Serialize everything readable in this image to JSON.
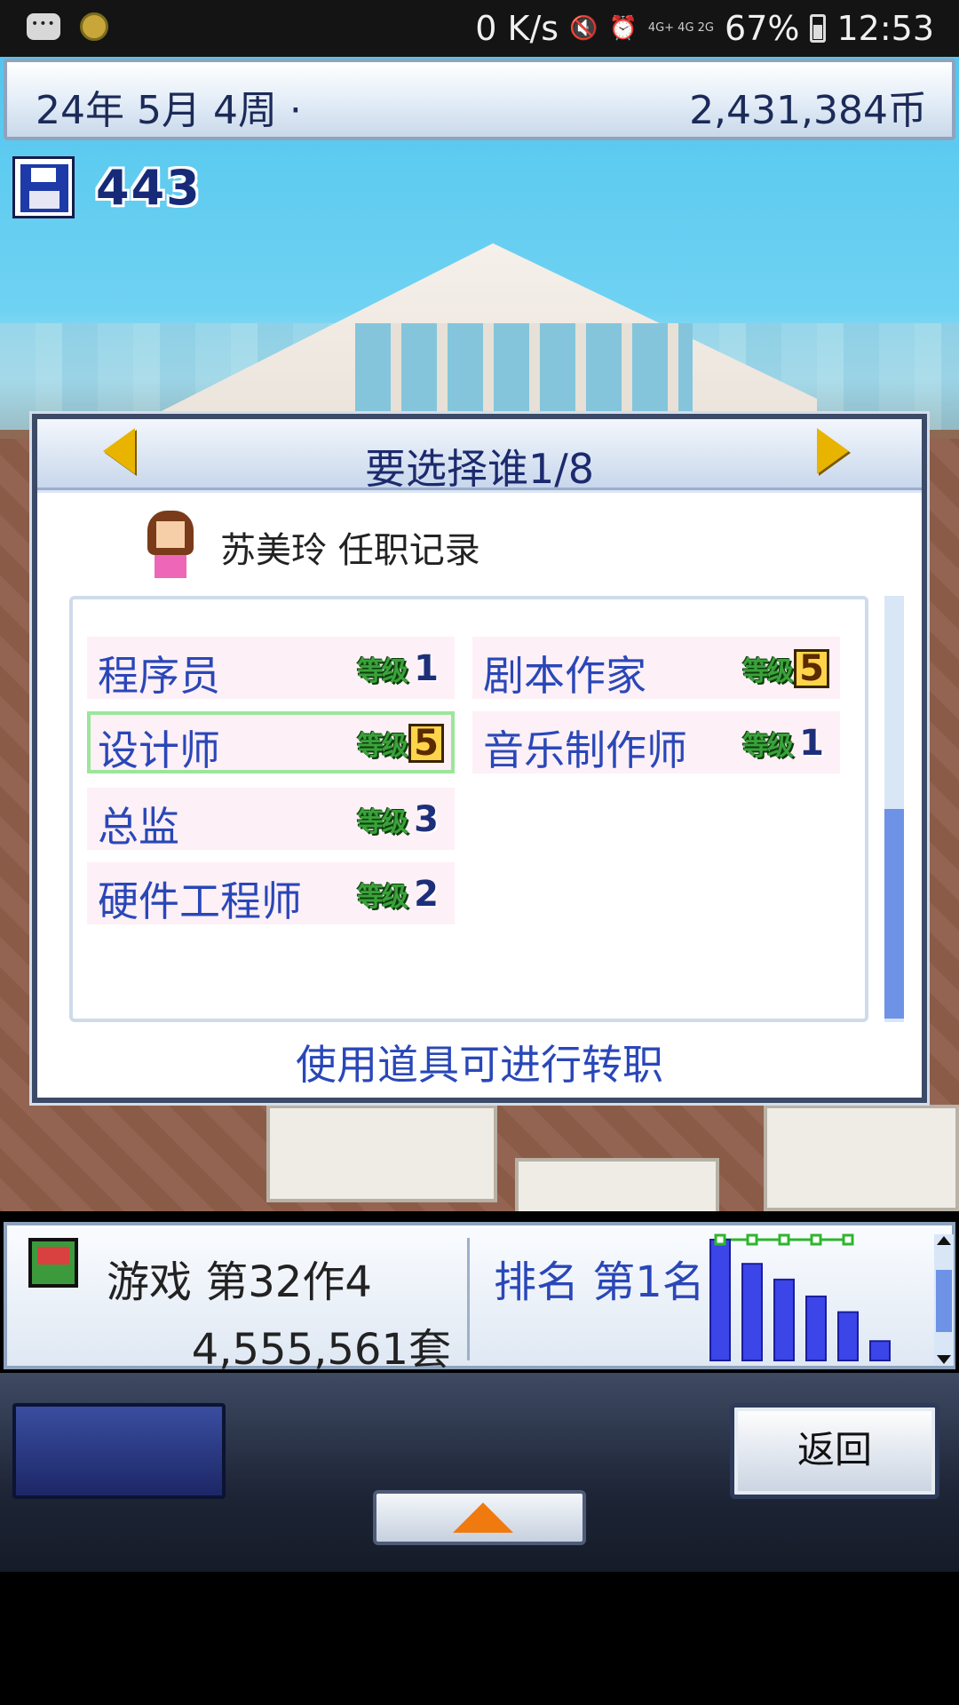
{
  "status_bar": {
    "speed": "0 K/s",
    "network": "4G+ 4G 2G",
    "battery": "67%",
    "time": "12:53"
  },
  "top_bar": {
    "date": "24年 5月 4周 ·",
    "money": "2,431,384币"
  },
  "save_count": "443",
  "dialog": {
    "title": "要选择谁1/8",
    "employee_record": "苏美玲 任职记录",
    "level_label": "等级",
    "jobs": [
      {
        "name": "程序员",
        "level": "1"
      },
      {
        "name": "剧本作家",
        "level": "5"
      },
      {
        "name": "设计师",
        "level": "5"
      },
      {
        "name": "音乐制作师",
        "level": "1"
      },
      {
        "name": "总监",
        "level": "3"
      },
      {
        "name": "硬件工程师",
        "level": "2"
      }
    ],
    "hint": "使用道具可进行转职"
  },
  "info_panel": {
    "game_title": "游戏 第32作4",
    "sales": "4,555,561套",
    "rank": "排名 第1名",
    "chart_data": {
      "type": "bar",
      "values": [
        100,
        80,
        67,
        53,
        40,
        16
      ]
    }
  },
  "controls": {
    "back_label": "返回"
  },
  "colors": {
    "accent_blue": "#2a47b8",
    "level_gold": "#ffd44a",
    "selection_green": "#9be69b",
    "up_arrow_orange": "#f07a10"
  }
}
